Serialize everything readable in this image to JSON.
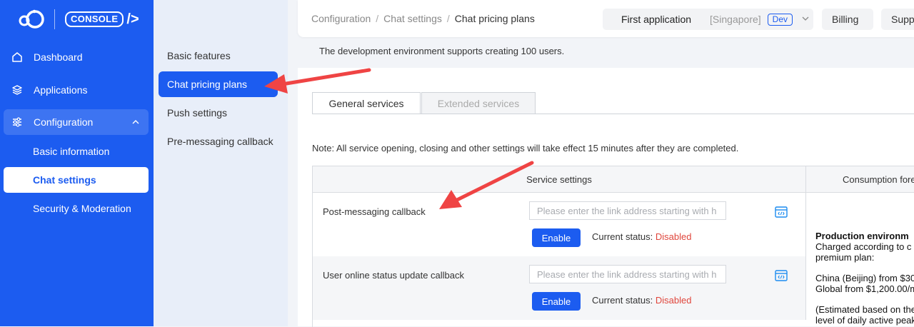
{
  "brand": {
    "console_label": "CONSOLE",
    "console_suffix": "/>"
  },
  "sidebar": {
    "items": [
      {
        "label": "Dashboard",
        "icon": "home-icon"
      },
      {
        "label": "Applications",
        "icon": "layers-icon"
      },
      {
        "label": "Configuration",
        "icon": "sliders-icon",
        "expanded": true
      }
    ],
    "sub_items": [
      {
        "label": "Basic information"
      },
      {
        "label": "Chat settings",
        "active": true
      },
      {
        "label": "Security & Moderation"
      }
    ]
  },
  "submenu": {
    "items": [
      {
        "label": "Basic features"
      },
      {
        "label": "Chat pricing plans",
        "active": true
      },
      {
        "label": "Push settings"
      },
      {
        "label": "Pre-messaging callback"
      }
    ]
  },
  "header": {
    "breadcrumb": [
      "Configuration",
      "Chat settings",
      "Chat pricing plans"
    ],
    "breadcrumb_sep": "/",
    "app_name": "First application",
    "region": "[Singapore]",
    "env": "Dev",
    "billing": "Billing",
    "support": "Suppo"
  },
  "main": {
    "notice": "The development environment supports creating 100 users.",
    "tabs": [
      {
        "label": "General services",
        "active": true
      },
      {
        "label": "Extended services",
        "active": false
      }
    ],
    "note": "Note: All service opening, closing and other settings will take effect 15 minutes after they are completed.",
    "table": {
      "headers": [
        "Service settings",
        "Consumption fore"
      ],
      "rows": [
        {
          "label": "Post-messaging callback",
          "placeholder": "Please enter the link address starting with h",
          "button": "Enable",
          "status_label": "Current status:",
          "status_value": "Disabled"
        },
        {
          "label": "User online status update callback",
          "placeholder": "Please enter the link address starting with h",
          "button": "Enable",
          "status_label": "Current status:",
          "status_value": "Disabled"
        }
      ],
      "consumption": {
        "title": "Production environm",
        "line1": "Charged according to c",
        "line2": "premium plan:",
        "line3": "China (Beijing) from $30",
        "line4": "Global from $1,200.00/m",
        "line5": "(Estimated based on the",
        "line6": "level of daily active peak"
      }
    }
  },
  "colors": {
    "primary": "#1c5cf0",
    "danger": "#e0463c",
    "annotation": "#ef4444"
  }
}
